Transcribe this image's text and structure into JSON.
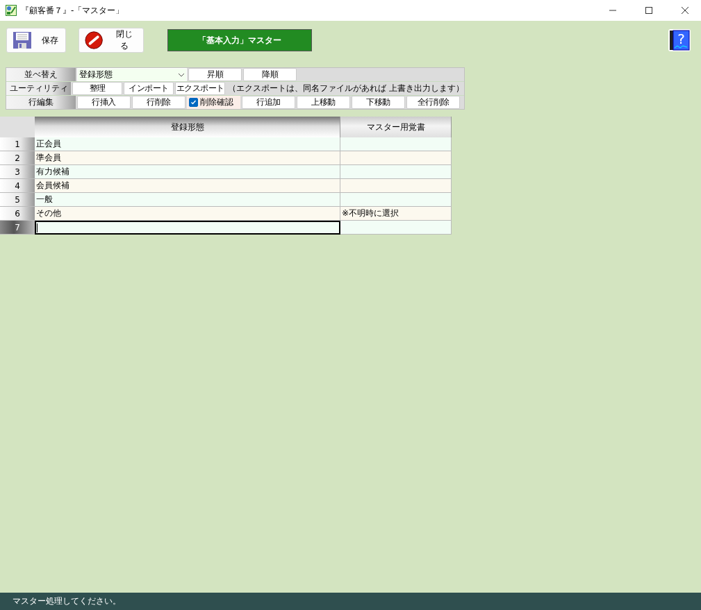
{
  "window": {
    "title": "『顧客番７』-「マスター」"
  },
  "toolbar": {
    "save": "保存",
    "close": "閉じる",
    "banner": "「基本入力」マスター",
    "help": "?"
  },
  "controls": {
    "sort": {
      "label": "並べ替え",
      "value": "登録形態",
      "buttons": [
        "昇順",
        "降順"
      ]
    },
    "utility": {
      "label": "ユーティリティ",
      "buttons": [
        "整理",
        "インポート",
        "エクスポート"
      ],
      "note": "（エクスポートは、同名ファイルがあれば 上書き出力します）"
    },
    "row_edit": {
      "label": "行編集",
      "buttons_before": [
        "行挿入",
        "行削除"
      ],
      "confirm": {
        "label": "削除確認",
        "checked": true
      },
      "buttons_after": [
        "行追加",
        "上移動",
        "下移動",
        "全行削除"
      ]
    }
  },
  "table": {
    "columns": [
      "登録形態",
      "マスター用覚書"
    ],
    "rows": [
      {
        "number": "1",
        "cells": [
          "正会員",
          ""
        ],
        "selected": false
      },
      {
        "number": "2",
        "cells": [
          "準会員",
          ""
        ],
        "selected": false
      },
      {
        "number": "3",
        "cells": [
          "有力候補",
          ""
        ],
        "selected": false
      },
      {
        "number": "4",
        "cells": [
          "会員候補",
          ""
        ],
        "selected": false
      },
      {
        "number": "5",
        "cells": [
          "一般",
          ""
        ],
        "selected": false
      },
      {
        "number": "6",
        "cells": [
          "その他",
          "※不明時に選択"
        ],
        "selected": false
      },
      {
        "number": "7",
        "cells": [
          "",
          ""
        ],
        "selected": true
      }
    ]
  },
  "status_bar": "マスター処理してください。"
}
